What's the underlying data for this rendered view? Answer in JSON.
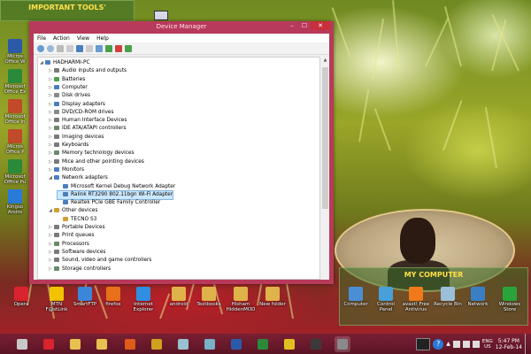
{
  "desktop": {
    "fence_top": {
      "title": "IMPORTANT TOOLS'"
    },
    "fence_bottom": {
      "title": "MY COMPUTER"
    },
    "left_icons": [
      {
        "label": "Micros Office W"
      },
      {
        "label": "Microsof Office Ex"
      },
      {
        "label": "Microsof Office In"
      },
      {
        "label": "Micros Office P"
      },
      {
        "label": "Microsof Office Pu"
      },
      {
        "label": "Kingso Andro"
      }
    ],
    "bottom_icons": [
      {
        "label": "Opera",
        "color": "#d9232e"
      },
      {
        "label": "MTN F@stLink",
        "color": "#f3c300"
      },
      {
        "label": "SmartFTP",
        "color": "#3b86d9"
      },
      {
        "label": "firefox",
        "color": "#e8701a"
      },
      {
        "label": "Internet Explorer",
        "color": "#2f8ee0"
      },
      {
        "label": "android",
        "color": "#e0b24a"
      },
      {
        "label": "Textbooks",
        "color": "#e0b24a"
      },
      {
        "label": "Hisham HiddenMOD",
        "color": "#e0b24a"
      },
      {
        "label": "New folder",
        "color": "#e0b24a"
      }
    ],
    "computer_icons": [
      {
        "label": "Computer",
        "color": "#4a8fd6"
      },
      {
        "label": "Control Panel",
        "color": "#47a0d8"
      },
      {
        "label": "avast! Free Antivirus",
        "color": "#f07a1a"
      },
      {
        "label": "Recycle Bin",
        "color": "#9bbfd8"
      },
      {
        "label": "Network",
        "color": "#3a7fc4"
      },
      {
        "label": "Windows Store",
        "color": "#2aa43a"
      }
    ]
  },
  "window": {
    "title": "Device Manager",
    "controls": {
      "minimize": "–",
      "maximize": "☐",
      "close": "✕"
    },
    "menu": [
      "File",
      "Action",
      "View",
      "Help"
    ],
    "tree": [
      {
        "label": "HADHARMI-PC",
        "level": 0,
        "expander": "◢",
        "icon_color": "#4a7fbf"
      },
      {
        "label": "Audio inputs and outputs",
        "level": 1,
        "expander": "▷",
        "icon_color": "#7a7a7a"
      },
      {
        "label": "Batteries",
        "level": 1,
        "expander": "▷",
        "icon_color": "#4aa04a"
      },
      {
        "label": "Computer",
        "level": 1,
        "expander": "▷",
        "icon_color": "#4a7fbf"
      },
      {
        "label": "Disk drives",
        "level": 1,
        "expander": "▷",
        "icon_color": "#8a8a8a"
      },
      {
        "label": "Display adapters",
        "level": 1,
        "expander": "▷",
        "icon_color": "#4a7fbf"
      },
      {
        "label": "DVD/CD-ROM drives",
        "level": 1,
        "expander": "▷",
        "icon_color": "#8a8a8a"
      },
      {
        "label": "Human Interface Devices",
        "level": 1,
        "expander": "▷",
        "icon_color": "#7a7a7a"
      },
      {
        "label": "IDE ATA/ATAPI controllers",
        "level": 1,
        "expander": "▷",
        "icon_color": "#6a8a6a"
      },
      {
        "label": "Imaging devices",
        "level": 1,
        "expander": "▷",
        "icon_color": "#7a7a7a"
      },
      {
        "label": "Keyboards",
        "level": 1,
        "expander": "▷",
        "icon_color": "#7a7a7a"
      },
      {
        "label": "Memory technology devices",
        "level": 1,
        "expander": "▷",
        "icon_color": "#6a8a6a"
      },
      {
        "label": "Mice and other pointing devices",
        "level": 1,
        "expander": "▷",
        "icon_color": "#7a7a7a"
      },
      {
        "label": "Monitors",
        "level": 1,
        "expander": "▷",
        "icon_color": "#4a7fbf"
      },
      {
        "label": "Network adapters",
        "level": 1,
        "expander": "◢",
        "icon_color": "#4a7fbf"
      },
      {
        "label": "Microsoft Kernel Debug Network Adapter",
        "level": 2,
        "expander": "",
        "icon_color": "#4a7fbf"
      },
      {
        "label": "Ralink RT3290 802.11bgn Wi-Fi Adapter",
        "level": 2,
        "expander": "",
        "icon_color": "#4a7fbf",
        "selected": true
      },
      {
        "label": "Realtek PCIe GBE Family Controller",
        "level": 2,
        "expander": "",
        "icon_color": "#4a7fbf"
      },
      {
        "label": "Other devices",
        "level": 1,
        "expander": "◢",
        "icon_color": "#d0a030"
      },
      {
        "label": "TECNO S3",
        "level": 2,
        "expander": "",
        "icon_color": "#d0a030"
      },
      {
        "label": "Portable Devices",
        "level": 1,
        "expander": "▷",
        "icon_color": "#7a7a7a"
      },
      {
        "label": "Print queues",
        "level": 1,
        "expander": "▷",
        "icon_color": "#7a7a7a"
      },
      {
        "label": "Processors",
        "level": 1,
        "expander": "▷",
        "icon_color": "#6a8a6a"
      },
      {
        "label": "Software devices",
        "level": 1,
        "expander": "▷",
        "icon_color": "#7a7a7a"
      },
      {
        "label": "Sound, video and game controllers",
        "level": 1,
        "expander": "▷",
        "icon_color": "#7a7a7a"
      },
      {
        "label": "Storage controllers",
        "level": 1,
        "expander": "▷",
        "icon_color": "#6a8a6a"
      }
    ]
  },
  "taskbar": {
    "items": [
      {
        "name": "start",
        "color": "#c8c8c8"
      },
      {
        "name": "opera",
        "color": "#d9232e"
      },
      {
        "name": "file-explorer",
        "color": "#e8c050"
      },
      {
        "name": "folder",
        "color": "#e8c050"
      },
      {
        "name": "media-player",
        "color": "#e05a1a"
      },
      {
        "name": "winamp",
        "color": "#d0a020"
      },
      {
        "name": "photos",
        "color": "#9ac0d0"
      },
      {
        "name": "notes",
        "color": "#7ab0c8"
      },
      {
        "name": "word",
        "color": "#2b5ba8"
      },
      {
        "name": "excel",
        "color": "#2a8a3a"
      },
      {
        "name": "pes",
        "color": "#e0c020"
      },
      {
        "name": "chrome-like",
        "color": "#3a3a3a"
      },
      {
        "name": "device-manager",
        "color": "#8a8a8a",
        "active": true
      }
    ],
    "tray": {
      "language": "ENG",
      "region": "US",
      "time": "5:47 PM",
      "date": "12-Feb-14"
    }
  }
}
